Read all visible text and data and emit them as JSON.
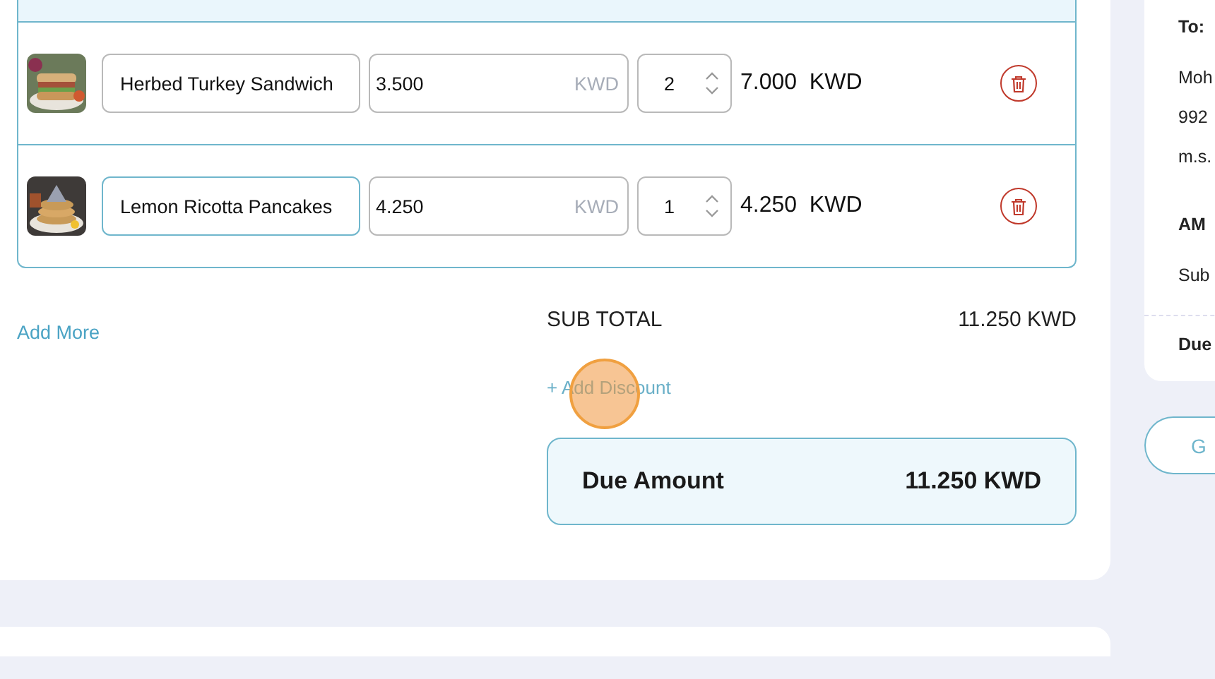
{
  "items": [
    {
      "name": "Herbed Turkey Sandwich",
      "price": "3.500",
      "currency": "KWD",
      "quantity": "2",
      "total": "7.000  KWD",
      "focused": false
    },
    {
      "name": "Lemon Ricotta Pancakes",
      "price": "4.250",
      "currency": "KWD",
      "quantity": "1",
      "total": "4.250  KWD",
      "focused": true
    }
  ],
  "add_more": "Add More",
  "sub_total": {
    "label": "SUB TOTAL",
    "value": "11.250 KWD"
  },
  "add_discount": "+ Add Discount",
  "due": {
    "label": "Due Amount",
    "value": "11.250 KWD"
  },
  "side_card": {
    "to_label": "To:",
    "lines": [
      "Moh",
      "992",
      "m.s."
    ],
    "amount_heading": "AM",
    "sub_label": "Sub",
    "due_label": "Due"
  },
  "side_button": "G"
}
